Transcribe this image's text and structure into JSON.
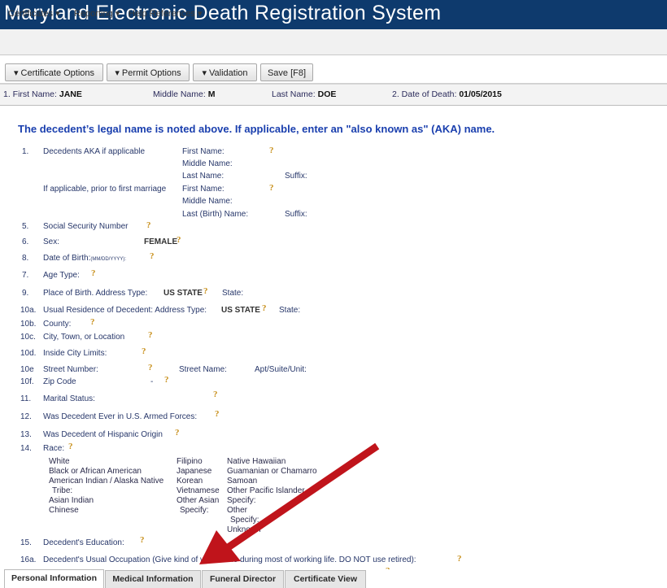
{
  "app": {
    "title": "Maryland Electronic Death Registration System"
  },
  "menu": {
    "items": [
      "Certificates ▾",
      "Reporting ▾",
      "Help References ▾"
    ]
  },
  "toolbar": {
    "certificate_options": "▾  Certificate Options",
    "permit_options": "▾  Permit Options",
    "validation": "▾  Validation",
    "save": "Save [F8]"
  },
  "namebar": {
    "first_label": "1. First Name:",
    "first_value": "JANE",
    "middle_label": "Middle Name:",
    "middle_value": "M",
    "last_label": "Last Name:",
    "last_value": "DOE",
    "dod_label": "2. Date of Death:",
    "dod_value": "01/05/2015"
  },
  "form": {
    "heading": "The decedent’s legal name is noted above. If applicable, enter an \"also known as\" (AKA) name.",
    "f1_num": "1.",
    "f1_label": "Decedents AKA if applicable",
    "aka_first": "First Name:",
    "aka_middle": "Middle Name:",
    "aka_last": "Last Name:",
    "aka_suffix": "Suffix:",
    "prior_label": "If applicable, prior to first marriage",
    "prior_first": "First Name:",
    "prior_middle": "Middle Name:",
    "prior_last": "Last (Birth) Name:",
    "prior_suffix": "Suffix:",
    "f5_num": "5.",
    "f5_label": "Social Security Number",
    "f6_num": "6.",
    "f6_label": "Sex:",
    "f6_value": "FEMALE",
    "f8_num": "8.",
    "f8_label": "Date of Birth:",
    "f8_fmt": "(MM/DD/YYYY):",
    "f7_num": "7.",
    "f7_label": "Age Type:",
    "f9_num": "9.",
    "f9_label": "Place of Birth. Address Type:",
    "f9_value": "US STATE",
    "f9_state": "State:",
    "f10a_num": "10a.",
    "f10a_label": "Usual Residence of Decedent: Address Type:",
    "f10a_value": "US STATE",
    "f10a_state": "State:",
    "f10b_num": "10b.",
    "f10b_label": "County:",
    "f10c_num": "10c.",
    "f10c_label": "City, Town, or Location",
    "f10d_num": "10d.",
    "f10d_label": "Inside City Limits:",
    "f10e_num": "10e",
    "f10e_label": "Street Number:",
    "f10e_street": "Street Name:",
    "f10e_apt": "Apt/Suite/Unit:",
    "f10f_num": "10f.",
    "f10f_label": "Zip Code",
    "f10f_dash": "-",
    "f11_num": "11.",
    "f11_label": "Marital Status:",
    "f12_num": "12.",
    "f12_label": "Was Decedent Ever in U.S. Armed Forces:",
    "f13_num": "13.",
    "f13_label": "Was Decedent of Hispanic Origin",
    "f14_num": "14.",
    "f14_label": "Race:",
    "f15_num": "15.",
    "f15_label": "Decedent's Education:",
    "f16a_num": "16a.",
    "f16a_label": "Decedent's Usual Occupation (Give kind of work done during most of working life. DO NOT use retired):"
  },
  "race": {
    "col1": [
      "White",
      "Black or African American",
      "American Indian / Alaska Native",
      "Tribe:",
      "Asian Indian",
      "Chinese"
    ],
    "col2": [
      "Filipino",
      "Japanese",
      "Korean",
      "Vietnamese",
      "Other Asian",
      "Specify:"
    ],
    "col3": [
      "Native Hawaiian",
      "Guamanian or Chamarro",
      "Samoan",
      "Other Pacific Islander",
      "Specify:",
      "Other",
      "Specify:",
      "Unknown"
    ]
  },
  "tabs": [
    "Personal Information",
    "Medical Information",
    "Funeral Director",
    "Certificate View"
  ],
  "colors": {
    "title_bar": "#0e3a6d",
    "heading": "#1a3fae",
    "help_icon": "#c8901c",
    "arrow": "#c0141b"
  }
}
